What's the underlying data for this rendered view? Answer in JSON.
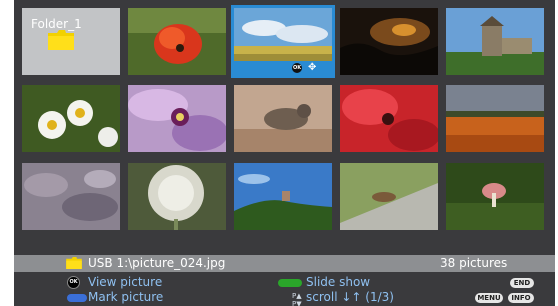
{
  "folder": {
    "name": "Folder_1",
    "icon": "folder-icon"
  },
  "selected_badges": {
    "ok": "OK",
    "move_icon": "move-arrows-icon"
  },
  "status": {
    "path": "USB 1:\\picture_024.jpg",
    "count": "38 pictures"
  },
  "help": {
    "view_picture": "View picture",
    "mark_picture": "Mark picture",
    "slide_show": "Slide show",
    "scroll": "scroll ↓↑ (1/3)",
    "ok_label": "OK",
    "end_label": "END",
    "menu_label": "MENU",
    "info_label": "INFO"
  },
  "colors": {
    "accent": "#2a8bd3",
    "help_text": "#8fc0f0"
  }
}
